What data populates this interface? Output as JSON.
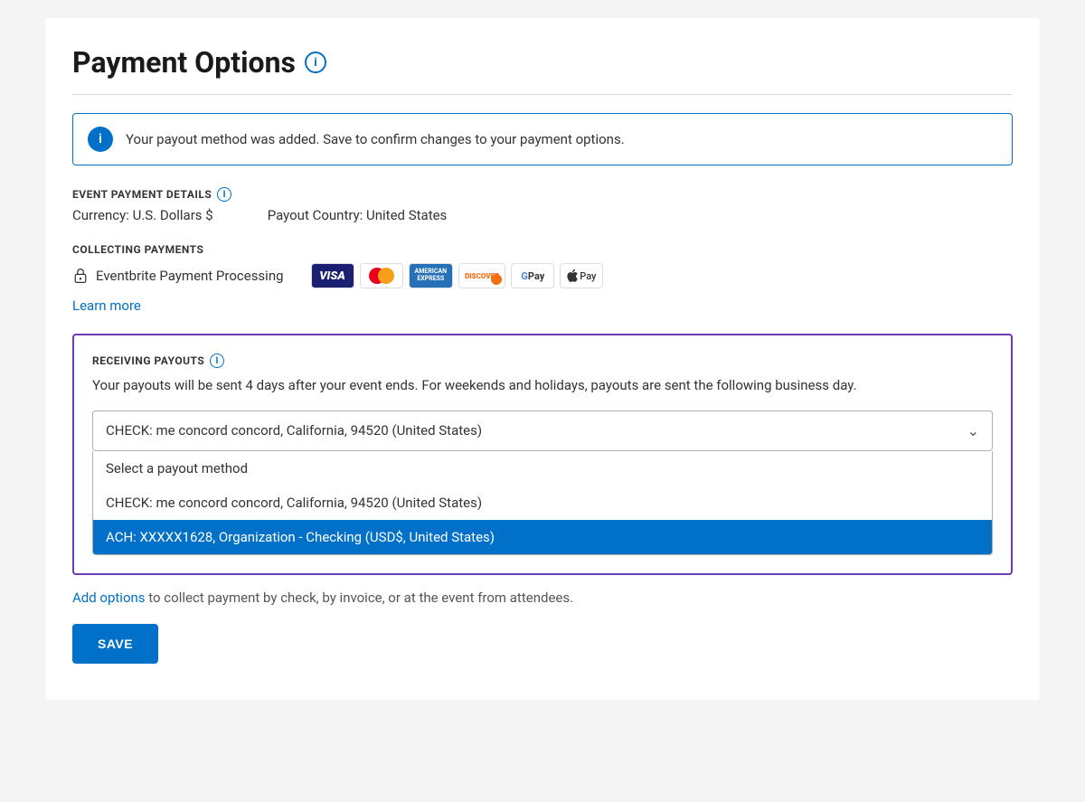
{
  "page": {
    "title": "Payment Options",
    "title_info_icon": "i"
  },
  "notification": {
    "icon": "i",
    "text": "Your payout method was added. Save to confirm changes to your payment options."
  },
  "event_payment_details": {
    "section_label": "EVENT PAYMENT DETAILS",
    "currency_label": "Currency: U.S. Dollars $",
    "payout_country_label": "Payout Country: United States"
  },
  "collecting_payments": {
    "section_label": "COLLECTING PAYMENTS",
    "processor_label": "Eventbrite Payment Processing",
    "learn_more_label": "Learn more",
    "cards": [
      {
        "name": "visa",
        "display": "VISA"
      },
      {
        "name": "mastercard",
        "display": "MC"
      },
      {
        "name": "amex",
        "display": "AMERICAN EXPRESS"
      },
      {
        "name": "discover",
        "display": "DISCOVER"
      },
      {
        "name": "gpay",
        "display": "G Pay"
      },
      {
        "name": "apay",
        "display": "Apple Pay"
      }
    ]
  },
  "receiving_payouts": {
    "section_label": "RECEIVING PAYOUTS",
    "description": "Your payouts will be sent 4 days after your event ends. For weekends and holidays, payouts are sent the following business day.",
    "dropdown": {
      "selected": "CHECK: me concord concord, California, 94520 (United States)",
      "options": [
        {
          "label": "Select a payout method",
          "value": "select",
          "selected": false
        },
        {
          "label": "CHECK: me concord concord, California, 94520 (United States)",
          "value": "check",
          "selected": false
        },
        {
          "label": "ACH: XXXXX1628, Organization - Checking (USD$, United States)",
          "value": "ach",
          "selected": true
        }
      ]
    },
    "add_options_prefix": "Add options",
    "add_options_suffix": " to collect payment by check, by invoice, or at the event from attendees."
  },
  "footer": {
    "save_label": "SAVE"
  }
}
